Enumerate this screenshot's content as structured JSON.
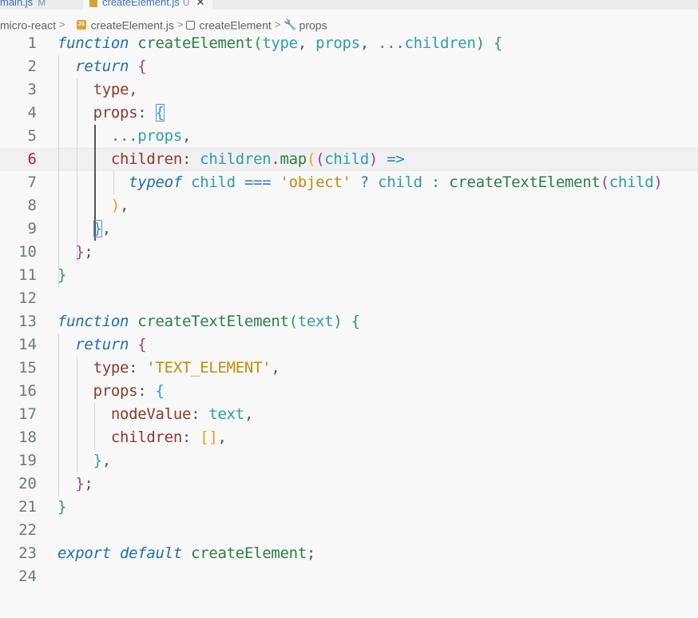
{
  "tabs": [
    {
      "label": "main.js",
      "status": "M"
    },
    {
      "label": "createElement.js",
      "status": "U",
      "close": "✕"
    }
  ],
  "breadcrumb": {
    "folder": "micro-react",
    "file": "createElement.js",
    "symbol": "createElement",
    "property": "props",
    "separator": ">"
  },
  "editor": {
    "active_line": 6,
    "line_numbers": [
      "1",
      "2",
      "3",
      "4",
      "5",
      "6",
      "7",
      "8",
      "9",
      "10",
      "11",
      "12",
      "13",
      "14",
      "15",
      "16",
      "17",
      "18",
      "19",
      "20",
      "21",
      "22",
      "23",
      "24"
    ]
  },
  "code": {
    "l1": [
      "function",
      "createElement",
      "(",
      "type",
      ", ",
      "props",
      ", ",
      "...",
      "children",
      ")",
      " ",
      "{"
    ],
    "l2": [
      "return",
      " ",
      "{"
    ],
    "l3": [
      "type",
      ","
    ],
    "l4": [
      "props",
      ": ",
      "{"
    ],
    "l5": [
      "...",
      "props",
      ","
    ],
    "l6": [
      "children",
      ": ",
      "children",
      ".",
      "map",
      "(",
      "(",
      "child",
      ")",
      " ",
      "=>"
    ],
    "l7": [
      "typeof",
      " ",
      "child",
      " ",
      "===",
      " ",
      "'object'",
      " ",
      "?",
      " ",
      "child",
      " ",
      ":",
      " ",
      "createTextElement",
      "(",
      "child",
      ")"
    ],
    "l8": [
      ")",
      ","
    ],
    "l9": [
      "}",
      ","
    ],
    "l10": [
      "}",
      ";"
    ],
    "l11": [
      "}"
    ],
    "l13": [
      "function",
      "createTextElement",
      "(",
      "text",
      ")",
      " ",
      "{"
    ],
    "l14": [
      "return",
      " ",
      "{"
    ],
    "l15": [
      "type",
      ": ",
      "'TEXT_ELEMENT'",
      ","
    ],
    "l16": [
      "props",
      ": ",
      "{"
    ],
    "l17": [
      "nodeValue",
      ": ",
      "text",
      ","
    ],
    "l18": [
      "children",
      ": ",
      "[]",
      ","
    ],
    "l19": [
      "}",
      ","
    ],
    "l20": [
      "}",
      ";"
    ],
    "l21": [
      "}"
    ],
    "l23": [
      "export",
      " ",
      "default",
      " ",
      "createElement",
      ";"
    ]
  }
}
